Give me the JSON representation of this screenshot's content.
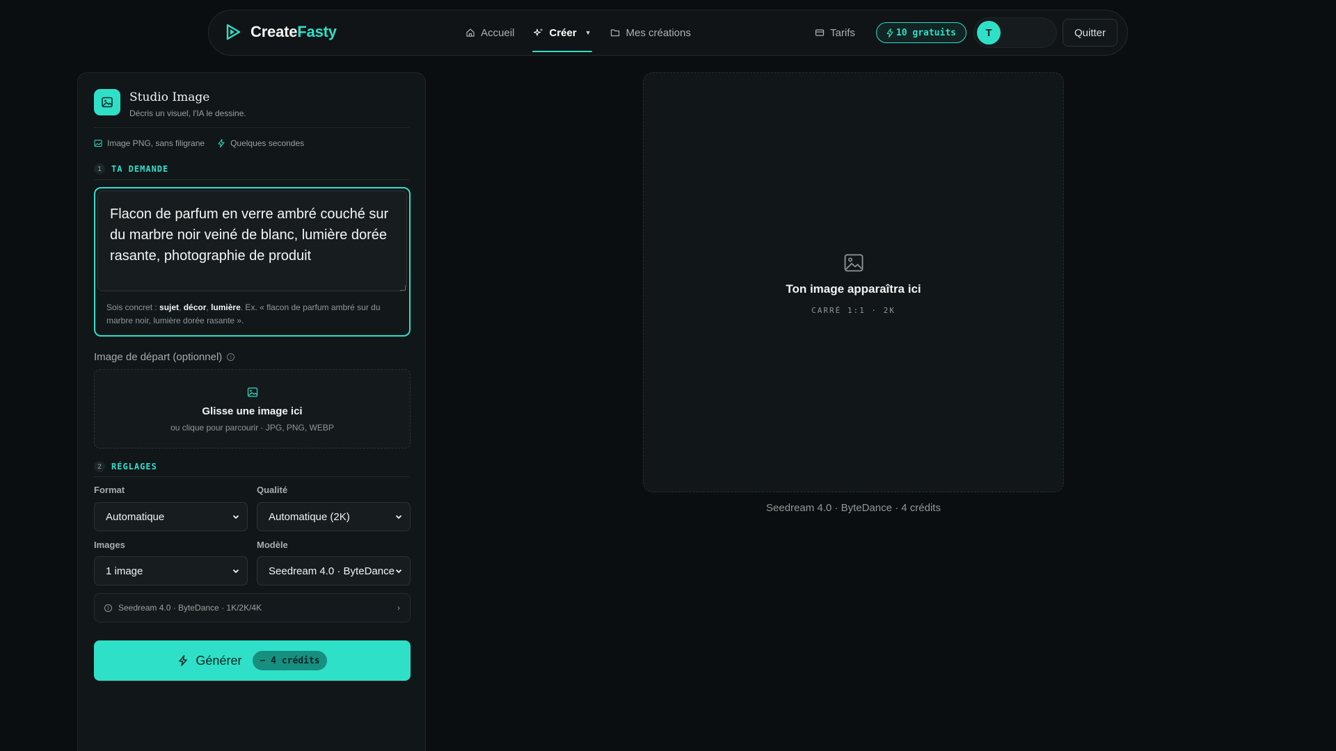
{
  "brand": {
    "part1": "Create",
    "part2": "Fasty"
  },
  "nav": {
    "links": [
      {
        "label": "Accueil",
        "icon": "home-icon"
      },
      {
        "label": "Créer",
        "icon": "sparkle-icon",
        "active": true
      },
      {
        "label": "Mes créations",
        "icon": "folder-icon"
      }
    ],
    "tarifs": "Tarifs",
    "credits": "10 gratuits",
    "avatar": "T",
    "quit": "Quitter"
  },
  "studio": {
    "title": "Studio Image",
    "subtitle": "Décris un visuel, l'IA le dessine.",
    "meta": [
      "Image PNG, sans filigrane",
      "Quelques secondes"
    ],
    "step1": {
      "num": "1",
      "label": "TA DEMANDE"
    },
    "prompt": "Flacon de parfum en verre ambré couché sur du marbre noir veiné de blanc, lumière dorée rasante, photographie de produit",
    "hint": {
      "prefix": "Sois concret : ",
      "k1": "sujet",
      "sep1": ", ",
      "k2": "décor",
      "sep2": ", ",
      "k3": "lumière",
      "suffix": ". Ex. « flacon de parfum ambré sur du marbre noir, lumière dorée rasante »."
    },
    "start_image": {
      "label": "Image de départ (optionnel)",
      "title": "Glisse une image ici",
      "sub": "ou clique pour parcourir · JPG, PNG, WEBP"
    },
    "step2": {
      "num": "2",
      "label": "RÉGLAGES"
    },
    "settings": {
      "format_label": "Format",
      "format_value": "Automatique",
      "quality_label": "Qualité",
      "quality_value": "Automatique (2K)",
      "images_label": "Images",
      "images_value": "1 image",
      "model_label": "Modèle",
      "model_value": "Seedream 4.0 · ByteDance"
    },
    "model_info": "Seedream 4.0 · ByteDance · 1K/2K/4K",
    "generate": {
      "label": "Générer",
      "badge": "− 4 crédits"
    }
  },
  "preview": {
    "title": "Ton image apparaîtra ici",
    "sub": "CARRÉ 1:1 · 2K",
    "caption": "Seedream 4.0 · ByteDance · 4 crédits"
  },
  "colors": {
    "accent": "#2fe0c8",
    "background": "#0b0e10",
    "panel": "#111619"
  }
}
